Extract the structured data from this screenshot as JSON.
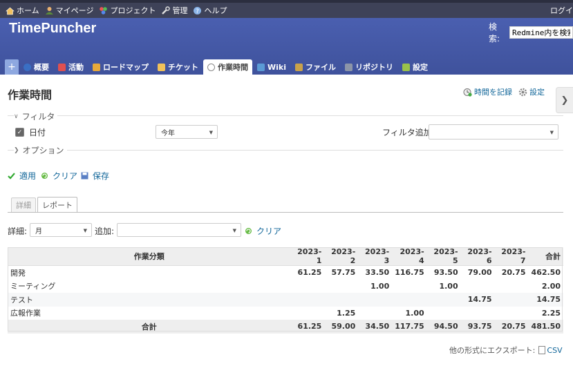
{
  "top_menu": {
    "items": [
      {
        "label": "ホーム",
        "icon": "home-icon"
      },
      {
        "label": "マイページ",
        "icon": "user-icon"
      },
      {
        "label": "プロジェクト",
        "icon": "projects-icon"
      },
      {
        "label": "管理",
        "icon": "wrench-icon"
      },
      {
        "label": "ヘルプ",
        "icon": "help-icon"
      }
    ],
    "login": "ログイ"
  },
  "header": {
    "title": "TimePuncher",
    "search_label": "検索:",
    "search_value": "Redmine内を検索"
  },
  "main_menu": {
    "new_label": "+",
    "tabs": [
      {
        "label": "概要",
        "icon": "info-icon",
        "color": "#3a6fc4"
      },
      {
        "label": "活動",
        "icon": "activity-icon",
        "color": "#e05050"
      },
      {
        "label": "ロードマップ",
        "icon": "roadmap-icon",
        "color": "#e8a93a"
      },
      {
        "label": "チケット",
        "icon": "ticket-icon",
        "color": "#f1c15a"
      },
      {
        "label": "作業時間",
        "icon": "clock-icon",
        "color": "#888888"
      },
      {
        "label": "Wiki",
        "icon": "wiki-icon",
        "color": "#5b9bd5"
      },
      {
        "label": "ファイル",
        "icon": "file-icon",
        "color": "#c9a24a"
      },
      {
        "label": "リポジトリ",
        "icon": "repository-icon",
        "color": "#8c95a8"
      },
      {
        "label": "設定",
        "icon": "settings-icon",
        "color": "#9ac24a"
      }
    ]
  },
  "page": {
    "title": "作業時間",
    "log_time": "時間を記録",
    "settings": "設定"
  },
  "filters": {
    "legend": "フィルタ",
    "date_label": "日付",
    "date_value": "今年",
    "add_label": "フィルタ追加",
    "add_value": ""
  },
  "options": {
    "legend": "オプション"
  },
  "actions": {
    "apply": "適用",
    "clear": "クリア",
    "save": "保存"
  },
  "report_tabs": [
    "詳細",
    "レポート"
  ],
  "criteria": {
    "detail_label": "詳細:",
    "detail_value": "月",
    "add_label": "追加:",
    "add_value": "",
    "clear": "クリア"
  },
  "report": {
    "header": [
      "作業分類",
      "2023-1",
      "2023-2",
      "2023-3",
      "2023-4",
      "2023-5",
      "2023-6",
      "2023-7",
      "合計"
    ],
    "rows": [
      [
        "開発",
        "61.25",
        "57.75",
        "33.50",
        "116.75",
        "93.50",
        "79.00",
        "20.75",
        "462.50"
      ],
      [
        "ミーティング",
        "",
        "",
        "1.00",
        "",
        "1.00",
        "",
        "",
        "2.00"
      ],
      [
        "テスト",
        "",
        "",
        "",
        "",
        "",
        "14.75",
        "",
        "14.75"
      ],
      [
        "広報作業",
        "",
        "1.25",
        "",
        "1.00",
        "",
        "",
        "",
        "2.25"
      ]
    ],
    "total": [
      "合計",
      "61.25",
      "59.00",
      "34.50",
      "117.75",
      "94.50",
      "93.75",
      "20.75",
      "481.50"
    ]
  },
  "export": {
    "label": "他の形式にエクスポート:",
    "csv": "CSV"
  }
}
